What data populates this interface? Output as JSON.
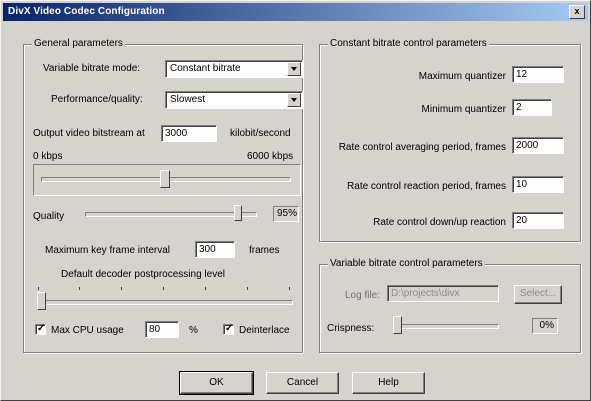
{
  "window": {
    "title": "DivX Video Codec Configuration",
    "close_label": "x"
  },
  "general": {
    "title": "General parameters",
    "vbr_mode_label": "Variable bitrate mode:",
    "vbr_mode_value": "Constant bitrate",
    "perf_label": "Performance/quality:",
    "perf_value": "Slowest",
    "bitrate_label": "Output video bitstream at",
    "bitrate_value": "3000",
    "bitrate_unit": "kilobit/second",
    "min_label": "0 kbps",
    "max_label": "6000 kbps",
    "bitrate_slider_fraction": 0.5,
    "quality_label": "Quality",
    "quality_value": "95%",
    "quality_slider_fraction": 0.92,
    "max_key_label": "Maximum key frame interval",
    "max_key_value": "300",
    "max_key_unit": "frames",
    "postproc_label": "Default decoder postprocessing level",
    "postproc_slider_fraction": 0.0,
    "max_cpu_label": "Max CPU usage",
    "max_cpu_value": "80",
    "max_cpu_unit": "%",
    "deinterlace_label": "Deinterlace"
  },
  "cbr": {
    "title": "Constant bitrate control parameters",
    "fields": [
      {
        "label": "Maximum quantizer",
        "value": "12"
      },
      {
        "label": "Minimum quantizer",
        "value": "2"
      },
      {
        "label": "Rate control averaging period, frames",
        "value": "2000"
      },
      {
        "label": "Rate control reaction period, frames",
        "value": "10"
      },
      {
        "label": "Rate control down/up reaction",
        "value": "20"
      }
    ]
  },
  "vbr": {
    "title": "Variable bitrate control parameters",
    "log_label": "Log file:",
    "log_value": "D:\\projects\\divx",
    "select_label": "Select...",
    "crispness_label": "Crispness:",
    "crispness_value": "0%",
    "crispness_slider_fraction": 0.0
  },
  "buttons": {
    "ok": "OK",
    "cancel": "Cancel",
    "help": "Help"
  }
}
